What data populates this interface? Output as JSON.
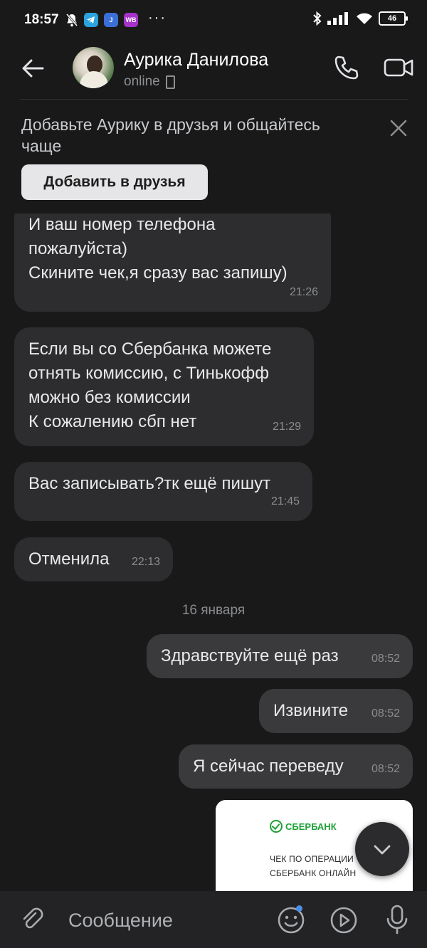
{
  "status_bar": {
    "time": "18:57",
    "battery": "46",
    "wb_label": "WB"
  },
  "header": {
    "contact_name": "Аурика Данилова",
    "presence": "online"
  },
  "banner": {
    "text": "Добавьте Аурику в друзья и общайтесь чаще",
    "button_label": "Добавить в друзья"
  },
  "messages": [
    {
      "direction": "in",
      "text": "И ваш номер телефона\nпожалуйста)\nСкините чек,я сразу вас запишу)",
      "time": "21:26"
    },
    {
      "direction": "in",
      "text": "Если вы со Сбербанка можете\nотнять комиссию, с Тинькофф\nможно без комиссии\nК сожалению сбп нет",
      "time": "21:29"
    },
    {
      "direction": "in",
      "text": "Вас записывать?тк ещё пишут",
      "time": "21:45"
    },
    {
      "direction": "in",
      "text": "Отменила",
      "time": "22:13"
    },
    {
      "direction": "out",
      "text": "Здравствуйте ещё раз",
      "time": "08:52"
    },
    {
      "direction": "out",
      "text": "Извините",
      "time": "08:52"
    },
    {
      "direction": "out",
      "text": "Я сейчас переведу",
      "time": "08:52"
    }
  ],
  "date_separator": "16 января",
  "receipt": {
    "bank_name": "СБЕРБАНК",
    "line1": "ЧЕК ПО ОПЕРАЦИИ",
    "line2": "СБЕРБАНК ОНЛАЙН"
  },
  "composer": {
    "placeholder": "Сообщение"
  },
  "icons": {
    "back": "arrow-left-icon",
    "call": "phone-icon",
    "video": "video-camera-icon",
    "close": "close-icon",
    "attach": "paperclip-icon",
    "emoji": "smiley-icon",
    "video_message": "play-circle-icon",
    "voice": "microphone-icon",
    "scroll": "chevron-down-icon"
  },
  "colors": {
    "background": "#19191a",
    "bubble_in": "#2d2d2f",
    "bubble_out": "#3a3a3c",
    "accent_green": "#21a038",
    "badge_blue": "#4a8fe7"
  }
}
